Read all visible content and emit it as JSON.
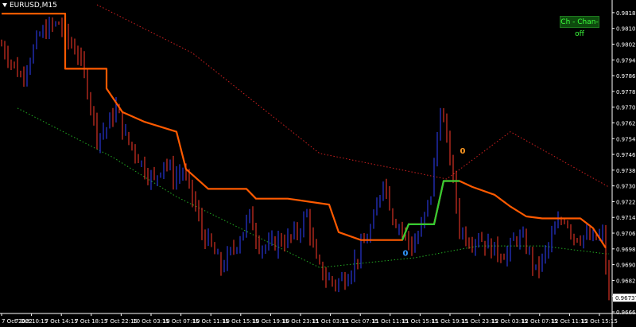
{
  "symbol": "EURUSD,M15",
  "chan_button_label": "Ch - Chan-off",
  "chart_data": {
    "type": "candlestick",
    "price_ticks": [
      "0.98185",
      "0.98105",
      "0.98025",
      "0.97945",
      "0.97865",
      "0.97785",
      "0.97705",
      "0.97625",
      "0.97545",
      "0.97465",
      "0.97385",
      "0.97305",
      "0.97225",
      "0.97145",
      "0.97065",
      "0.96985",
      "0.96905",
      "0.96825",
      "0.96745",
      "0.96665"
    ],
    "current_price": "0.96737",
    "time_ticks": [
      "7 Oct 2022",
      "7 Oct 10:15",
      "7 Oct 14:15",
      "7 Oct 18:15",
      "7 Oct 22:15",
      "10 Oct 03:15",
      "10 Oct 07:15",
      "10 Oct 11:15",
      "10 Oct 15:15",
      "10 Oct 19:15",
      "10 Oct 23:15",
      "11 Oct 03:15",
      "11 Oct 07:15",
      "11 Oct 11:15",
      "11 Oct 15:15",
      "11 Oct 19:15",
      "11 Oct 23:15",
      "12 Oct 03:15",
      "12 Oct 07:15",
      "12 Oct 11:15",
      "12 Oct 15:15"
    ],
    "ylim": [
      0.96665,
      0.98225
    ],
    "colors": {
      "background": "#000000",
      "bull_candle": "#3040ff",
      "bear_candle": "#ff3a2a",
      "stop_line": "#ff5a00",
      "stop_line_up": "#33cc33",
      "dotted_ma": "#d02020",
      "dotted_green": "#22aa22",
      "axis_text": "#ffffff"
    },
    "close_path": [
      [
        0,
        0.9802
      ],
      [
        3,
        0.9794
      ],
      [
        6,
        0.9786
      ],
      [
        9,
        0.9796
      ],
      [
        12,
        0.9807
      ],
      [
        15,
        0.9811
      ],
      [
        18,
        0.9813
      ],
      [
        21,
        0.9804
      ],
      [
        24,
        0.9798
      ],
      [
        27,
        0.978
      ],
      [
        30,
        0.9756
      ],
      [
        33,
        0.976
      ],
      [
        36,
        0.977
      ],
      [
        39,
        0.9755
      ],
      [
        42,
        0.9748
      ],
      [
        45,
        0.9739
      ],
      [
        48,
        0.9733
      ],
      [
        51,
        0.9744
      ],
      [
        54,
        0.9735
      ],
      [
        57,
        0.9738
      ],
      [
        60,
        0.9725
      ],
      [
        63,
        0.9707
      ],
      [
        66,
        0.9699
      ],
      [
        69,
        0.9689
      ],
      [
        72,
        0.9696
      ],
      [
        75,
        0.9705
      ],
      [
        78,
        0.9715
      ],
      [
        81,
        0.9701
      ],
      [
        84,
        0.9699
      ],
      [
        87,
        0.9703
      ],
      [
        90,
        0.9703
      ],
      [
        93,
        0.9707
      ],
      [
        96,
        0.9716
      ],
      [
        99,
        0.9691
      ],
      [
        102,
        0.9684
      ],
      [
        105,
        0.9681
      ],
      [
        108,
        0.9684
      ],
      [
        111,
        0.9692
      ],
      [
        114,
        0.9701
      ],
      [
        117,
        0.9712
      ],
      [
        120,
        0.9735
      ],
      [
        123,
        0.9715
      ],
      [
        126,
        0.9708
      ],
      [
        129,
        0.9699
      ],
      [
        132,
        0.9709
      ],
      [
        135,
        0.9727
      ],
      [
        138,
        0.977
      ],
      [
        141,
        0.9745
      ],
      [
        144,
        0.9709
      ],
      [
        147,
        0.9703
      ],
      [
        150,
        0.9705
      ],
      [
        153,
        0.97
      ],
      [
        156,
        0.9697
      ],
      [
        159,
        0.9696
      ],
      [
        162,
        0.9705
      ],
      [
        165,
        0.97
      ],
      [
        168,
        0.9687
      ],
      [
        171,
        0.9696
      ],
      [
        174,
        0.9708
      ],
      [
        177,
        0.9715
      ],
      [
        180,
        0.9705
      ],
      [
        183,
        0.9705
      ],
      [
        186,
        0.9703
      ],
      [
        189,
        0.9705
      ],
      [
        191,
        0.9674
      ]
    ],
    "stop_path": [
      [
        0,
        0.9818
      ],
      [
        20,
        0.9818
      ],
      [
        20,
        0.979
      ],
      [
        33,
        0.979
      ],
      [
        33,
        0.978
      ],
      [
        38,
        0.9768
      ],
      [
        45,
        0.9763
      ],
      [
        55,
        0.9758
      ],
      [
        58,
        0.9739
      ],
      [
        65,
        0.9729
      ],
      [
        77,
        0.9729
      ],
      [
        80,
        0.9724
      ],
      [
        90,
        0.9724
      ],
      [
        103,
        0.9721
      ],
      [
        106,
        0.9707
      ],
      [
        113,
        0.9703
      ],
      [
        126,
        0.9703
      ],
      [
        128,
        0.9711
      ],
      [
        136,
        0.9711
      ],
      [
        139,
        0.9733
      ],
      [
        144,
        0.9733
      ],
      [
        148,
        0.973
      ],
      [
        155,
        0.9726
      ],
      [
        160,
        0.972
      ],
      [
        165,
        0.9715
      ],
      [
        170,
        0.9714
      ],
      [
        182,
        0.9714
      ],
      [
        186,
        0.9709
      ],
      [
        190,
        0.9699
      ]
    ],
    "stop_up_range": [
      126,
      145
    ],
    "ma_red": [
      [
        30,
        0.98225
      ],
      [
        60,
        0.9798
      ],
      [
        100,
        0.9747
      ],
      [
        140,
        0.9734
      ],
      [
        160,
        0.9758
      ],
      [
        192,
        0.9729
      ]
    ],
    "ma_green": [
      [
        5,
        0.977
      ],
      [
        35,
        0.9745
      ],
      [
        55,
        0.9725
      ],
      [
        70,
        0.9713
      ],
      [
        100,
        0.9689
      ],
      [
        130,
        0.9694
      ],
      [
        150,
        0.97
      ],
      [
        170,
        0.97
      ],
      [
        190,
        0.9696
      ]
    ],
    "markers": [
      {
        "index": 127,
        "price": 0.9695,
        "color": "#3399ff",
        "label": "0"
      },
      {
        "index": 145,
        "price": 0.9747,
        "color": "#ff9922",
        "label": "0"
      }
    ]
  }
}
